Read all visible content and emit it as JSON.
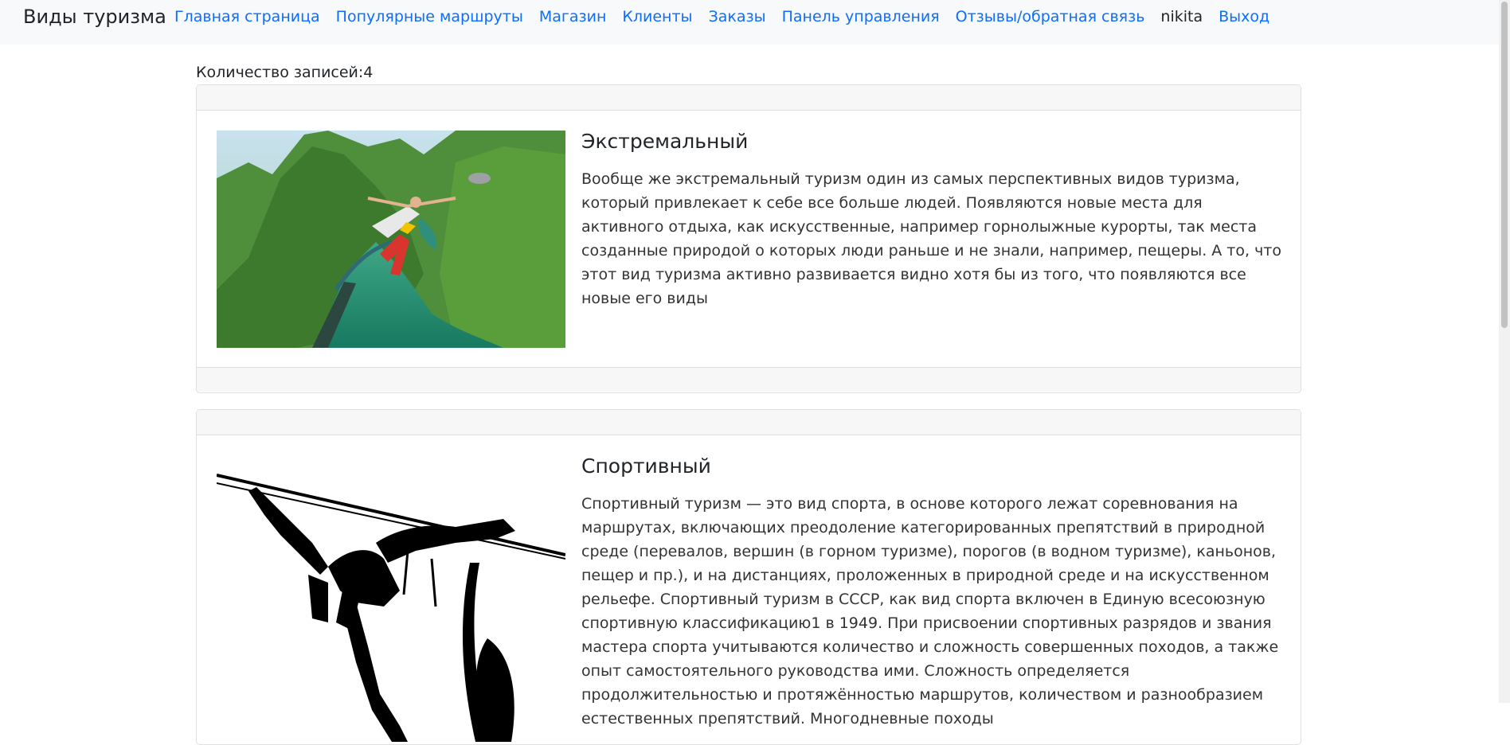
{
  "navbar": {
    "brand": "Виды туризма",
    "links": [
      "Главная страница",
      "Популярные маршруты",
      "Магазин",
      "Клиенты",
      "Заказы",
      "Панель управления",
      "Отзывы/обратная связь"
    ],
    "username": "nikita",
    "logout": "Выход"
  },
  "records": {
    "count_label": "Количество записей:4"
  },
  "cards": [
    {
      "title": "Экстремальный",
      "description": "Вообще же экстремальный туризм один из самых перспективных видов туризма, который привлекает к себе все больше людей. Появляются новые места для активного отдыха, как искусственные, например горнолыжные курорты, так места созданные природой о которых люди раньше и не знали, например, пещеры. А то, что этот вид туризма активно развивается видно хотя бы из того, что появляются все новые его виды",
      "image": "bungee-jump-photo"
    },
    {
      "title": "Спортивный",
      "description": "Спортивный туризм — это вид спорта, в основе которого лежат соревнования на маршрутах, включающих преодоление категорированных препятствий в природной среде (перевалов, вершин (в горном туризме), порогов (в водном туризме), каньонов, пещер и пр.), и на дистанциях, проложенных в природной среде и на искусственном рельефе. Спортивный туризм в СССР, как вид спорта включен в Единую всесоюзную спортивную классификацию1 в 1949. При присвоении спортивных разрядов и звания мастера спорта учитываются количество и сложность совершенных походов, а также опыт самостоятельного руководства ими. Сложность определяется продолжительностью и протяжённостью маршрутов, количеством и разнообразием естественных препятствий. Многодневные походы",
      "image": "zipline-climber-silhouette"
    }
  ],
  "colors": {
    "link": "#0d6efd",
    "navbar_bg": "#f8f9fa",
    "card_header_bg": "#f7f7f7",
    "card_border": "#dfdfdf"
  }
}
